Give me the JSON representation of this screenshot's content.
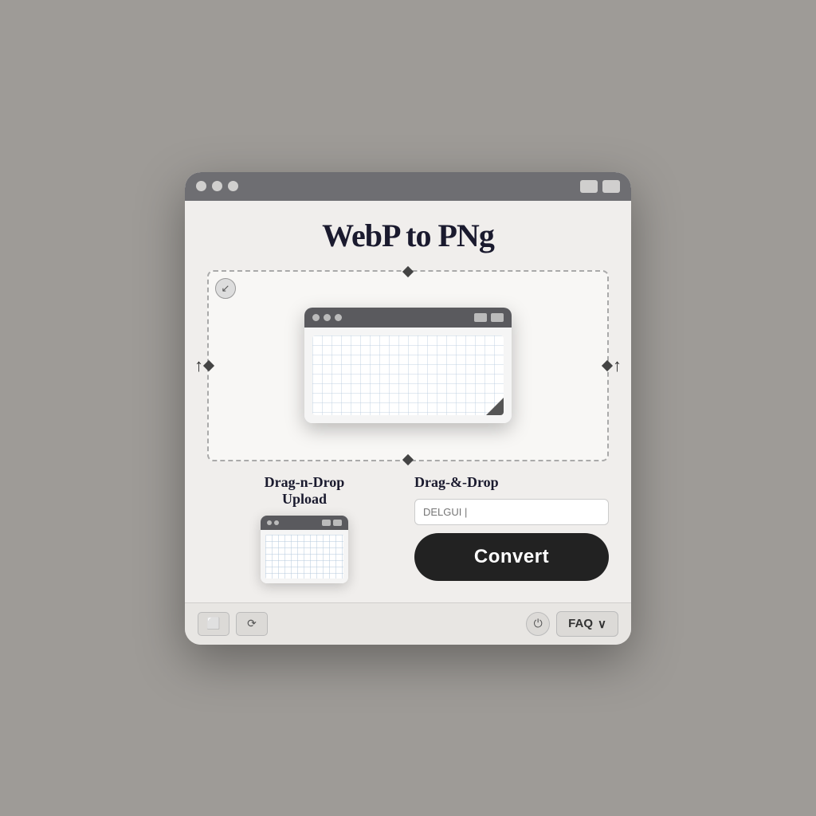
{
  "app": {
    "title": "WebP to PNg",
    "window": {
      "dots": [
        "dot1",
        "dot2",
        "dot3"
      ],
      "controls": [
        "minimize",
        "maximize"
      ]
    }
  },
  "upload_area": {
    "drag_drop_label": "Drag-n-Drop\nUpload",
    "drag_drop_label_right": "Drag-&-Drop",
    "file_input_placeholder": "DELGUI |"
  },
  "convert_button": {
    "label": "Convert"
  },
  "bottom_bar": {
    "btn1_icon": "⬜",
    "btn2_icon": "⟳",
    "faq_icon": "⏻",
    "faq_label": "FAQ",
    "faq_chevron": "∨"
  }
}
